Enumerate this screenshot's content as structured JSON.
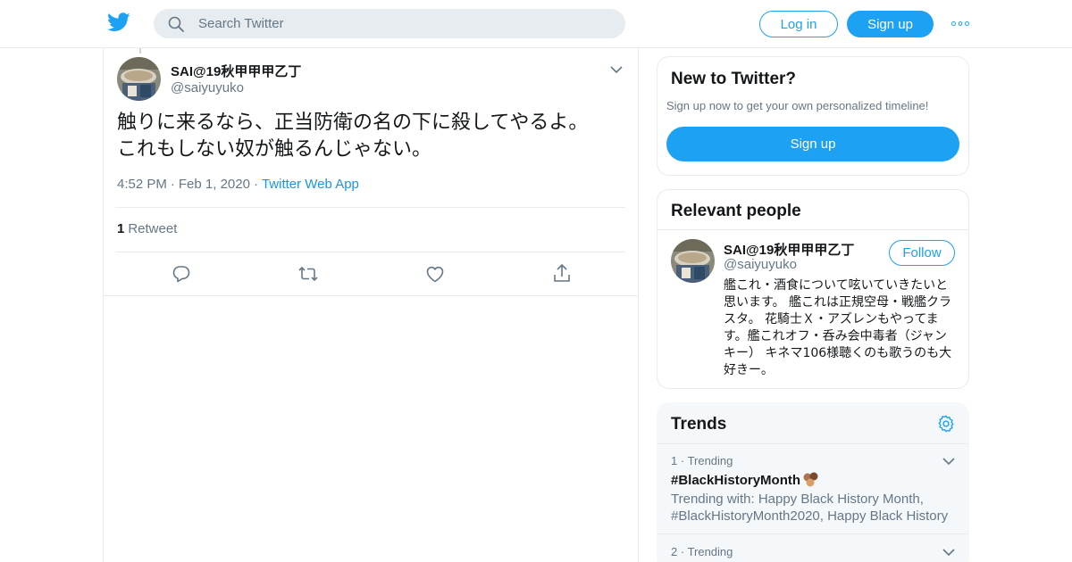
{
  "header": {
    "search_placeholder": "Search Twitter",
    "login_label": "Log in",
    "signup_label": "Sign up",
    "logo_icon": "twitter-bird-icon",
    "more_icon": "more-dots-icon"
  },
  "tweet": {
    "author_name": "SAI@19秋甲甲甲乙丁",
    "author_handle": "@saiyuyuko",
    "text_line1": "触りに来るなら、正当防衛の名の下に殺してやるよ。",
    "text_line2": "これもしない奴が触るんじゃない。",
    "time": "4:52 PM",
    "date": "Feb 1, 2020",
    "source": "Twitter Web App",
    "retweet_count": "1",
    "retweet_label": "Retweet",
    "actions": [
      "reply-icon",
      "retweet-icon",
      "like-icon",
      "share-icon"
    ]
  },
  "sidebar": {
    "new_to_twitter": {
      "title": "New to Twitter?",
      "subtitle": "Sign up now to get your own personalized timeline!",
      "signup_label": "Sign up"
    },
    "relevant_people": {
      "title": "Relevant people",
      "name": "SAI@19秋甲甲甲乙丁",
      "handle": "@saiyuyuko",
      "follow_label": "Follow",
      "bio": "艦これ・酒食について呟いていきたいと思います。 艦これは正規空母・戦艦クラスタ。 花騎士Ｘ・アズレンもやってます。艦これオフ・呑み会中毒者（ジャンキー） キネマ106様聴くのも歌うのも大好きー。"
    },
    "trends": {
      "title": "Trends",
      "items": [
        {
          "rank": "1",
          "meta": "Trending",
          "name": "#BlackHistoryMonth",
          "trending_with": "Trending with: Happy Black History Month, #BlackHistoryMonth2020, Happy Black History"
        },
        {
          "rank": "2",
          "meta": "Trending"
        }
      ]
    }
  },
  "colors": {
    "accent": "#1da1f2",
    "muted": "#657786",
    "border": "#e6ecf0"
  }
}
